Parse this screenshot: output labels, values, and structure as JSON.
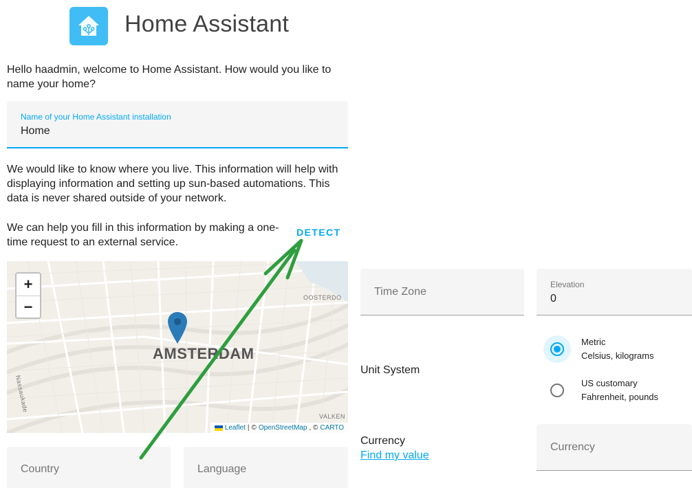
{
  "header": {
    "title": "Home Assistant",
    "logo_icon": "home-assistant-logo-icon",
    "logo_color": "#41bdf5"
  },
  "intro": {
    "greeting": "Hello haadmin, welcome to Home Assistant. How would you like to name your home?"
  },
  "name_field": {
    "label": "Name of your Home Assistant installation",
    "value": "Home"
  },
  "location": {
    "description": "We would like to know where you live. This information will help with displaying information and setting up sun-based automations. This data is never shared outside of your network.",
    "detect_text": "We can help you fill in this information by making a one-time request to an external service.",
    "detect_button": "DETECT"
  },
  "map": {
    "zoom_in": "+",
    "zoom_out": "−",
    "city_label": "AMSTERDAM",
    "district_top_right": "OOSTERDO",
    "district_bottom_right": "VALKEN",
    "street_left": "Nassaukade",
    "attribution": {
      "leaflet": "Leaflet",
      "sep1": "|",
      "copy1": "©",
      "osm": "OpenStreetMap",
      "copy2": ", ©",
      "carto": "CARTO"
    },
    "pin_color": "#2b7bb9"
  },
  "fields": {
    "country": {
      "placeholder": "Country"
    },
    "language": {
      "placeholder": "Language"
    },
    "time_zone": {
      "placeholder": "Time Zone"
    },
    "elevation": {
      "label": "Elevation",
      "value": "0"
    },
    "currency": {
      "placeholder": "Currency"
    }
  },
  "unit_system": {
    "label": "Unit System",
    "options": [
      {
        "title": "Metric",
        "subtitle": "Celsius, kilograms",
        "checked": true
      },
      {
        "title": "US customary",
        "subtitle": "Fahrenheit, pounds",
        "checked": false
      }
    ]
  },
  "currency_section": {
    "label": "Currency",
    "link": "Find my value"
  },
  "colors": {
    "accent": "#03a9f4",
    "annotation_arrow": "#2e9e3e"
  }
}
